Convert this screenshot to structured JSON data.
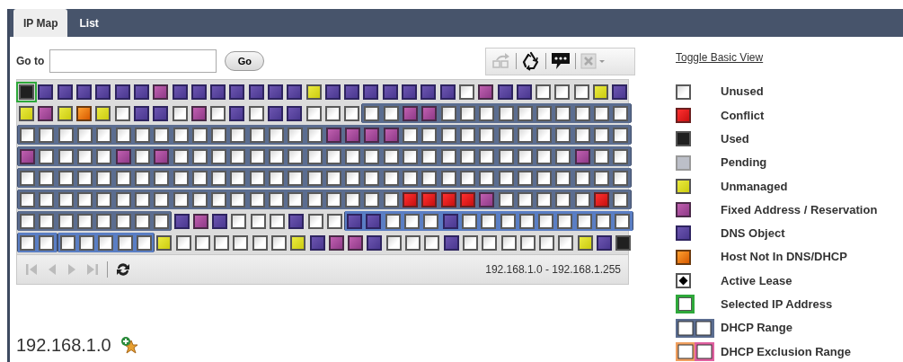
{
  "tabs": [
    {
      "label": "IP Map",
      "selected": true
    },
    {
      "label": "List",
      "selected": false
    }
  ],
  "goto": {
    "label": "Go to",
    "button": "Go"
  },
  "grid_rows": [
    {
      "cells": [
        {
          "kind": "used",
          "selected": true
        },
        {
          "kind": "dns",
          "selected": false
        },
        {
          "kind": "dns",
          "selected": false
        },
        {
          "kind": "dns",
          "selected": false
        },
        {
          "kind": "dns",
          "selected": false
        },
        {
          "kind": "dns",
          "selected": false
        },
        {
          "kind": "dns",
          "selected": false
        },
        {
          "kind": "fixed",
          "selected": false
        },
        {
          "kind": "dns",
          "selected": false
        },
        {
          "kind": "dns",
          "selected": false
        },
        {
          "kind": "dns",
          "selected": false
        },
        {
          "kind": "dns",
          "selected": false
        },
        {
          "kind": "dns",
          "selected": false
        },
        {
          "kind": "dns",
          "selected": false
        },
        {
          "kind": "dns",
          "selected": false
        },
        {
          "kind": "unmanaged",
          "selected": false
        },
        {
          "kind": "dns",
          "selected": false
        },
        {
          "kind": "dns",
          "selected": false
        },
        {
          "kind": "dns",
          "selected": false
        },
        {
          "kind": "dns",
          "selected": false
        },
        {
          "kind": "dns",
          "selected": false
        },
        {
          "kind": "dns",
          "selected": false
        },
        {
          "kind": "dns",
          "selected": false
        },
        {
          "kind": "unused",
          "selected": false
        },
        {
          "kind": "fixed",
          "selected": false
        },
        {
          "kind": "dns",
          "selected": false
        },
        {
          "kind": "dns",
          "selected": false
        },
        {
          "kind": "unused",
          "selected": false
        },
        {
          "kind": "unused",
          "selected": false
        },
        {
          "kind": "unused",
          "selected": false
        },
        {
          "kind": "unmanaged",
          "selected": false
        },
        {
          "kind": "dns",
          "selected": false
        }
      ]
    },
    {
      "cells": [
        {
          "kind": "unmanaged",
          "selected": false
        },
        {
          "kind": "fixed",
          "selected": false
        },
        {
          "kind": "unmanaged",
          "selected": false
        },
        {
          "kind": "host",
          "selected": false
        },
        {
          "kind": "unmanaged",
          "selected": false
        },
        {
          "kind": "unused",
          "selected": false
        },
        {
          "kind": "dns",
          "selected": false
        },
        {
          "kind": "dns",
          "selected": false
        },
        {
          "kind": "unused",
          "selected": false
        },
        {
          "kind": "fixed",
          "selected": false
        },
        {
          "kind": "unused",
          "selected": false
        },
        {
          "kind": "dns",
          "selected": false
        },
        {
          "kind": "unused",
          "selected": false
        },
        {
          "kind": "dns",
          "selected": false
        },
        {
          "kind": "dns",
          "selected": false
        },
        {
          "kind": "unused",
          "selected": false
        },
        {
          "kind": "unused",
          "selected": false
        },
        {
          "kind": "unused",
          "selected": false
        },
        {
          "kind": "unused",
          "selected": false,
          "color": "#5b6d90",
          "range_start": true
        },
        {
          "kind": "unused",
          "selected": false,
          "color": "#5b6d90"
        },
        {
          "kind": "fixed",
          "selected": false,
          "color": "#5b6d90"
        },
        {
          "kind": "fixed",
          "selected": false,
          "color": "#5b6d90"
        },
        {
          "kind": "unused",
          "selected": false,
          "color": "#5b6d90"
        },
        {
          "kind": "unused",
          "selected": false,
          "color": "#5b6d90"
        },
        {
          "kind": "unused",
          "selected": false,
          "color": "#5b6d90"
        },
        {
          "kind": "unused",
          "selected": false,
          "color": "#5b6d90"
        },
        {
          "kind": "unused",
          "selected": false,
          "color": "#5b6d90"
        },
        {
          "kind": "unused",
          "selected": false,
          "color": "#5b6d90"
        },
        {
          "kind": "unused",
          "selected": false,
          "color": "#5b6d90"
        },
        {
          "kind": "unused",
          "selected": false,
          "color": "#5b6d90"
        },
        {
          "kind": "unused",
          "selected": false,
          "color": "#5b6d90"
        },
        {
          "kind": "unused",
          "selected": false,
          "color": "#5b6d90"
        }
      ]
    },
    {
      "cells": [
        {
          "kind": "unused",
          "selected": false,
          "color": "#5b6d90"
        },
        {
          "kind": "unused",
          "selected": false,
          "color": "#5b6d90"
        },
        {
          "kind": "unused",
          "selected": false,
          "color": "#5b6d90"
        },
        {
          "kind": "unused",
          "selected": false,
          "color": "#5b6d90"
        },
        {
          "kind": "unused",
          "selected": false,
          "color": "#5b6d90"
        },
        {
          "kind": "unused",
          "selected": false,
          "color": "#5b6d90"
        },
        {
          "kind": "unused",
          "selected": false,
          "color": "#5b6d90"
        },
        {
          "kind": "unused",
          "selected": false,
          "color": "#5b6d90"
        },
        {
          "kind": "unused",
          "selected": false,
          "color": "#5b6d90"
        },
        {
          "kind": "unused",
          "selected": false,
          "color": "#5b6d90"
        },
        {
          "kind": "unused",
          "selected": false,
          "color": "#5b6d90"
        },
        {
          "kind": "unused",
          "selected": false,
          "color": "#5b6d90"
        },
        {
          "kind": "unused",
          "selected": false,
          "color": "#5b6d90"
        },
        {
          "kind": "unused",
          "selected": false,
          "color": "#5b6d90"
        },
        {
          "kind": "unused",
          "selected": false,
          "color": "#5b6d90"
        },
        {
          "kind": "unused",
          "selected": false,
          "color": "#5b6d90"
        },
        {
          "kind": "fixed",
          "selected": false,
          "color": "#5b6d90"
        },
        {
          "kind": "fixed",
          "selected": false,
          "color": "#5b6d90"
        },
        {
          "kind": "fixed",
          "selected": false,
          "color": "#5b6d90"
        },
        {
          "kind": "fixed",
          "selected": false,
          "color": "#5b6d90"
        },
        {
          "kind": "unused",
          "selected": false,
          "color": "#5b6d90"
        },
        {
          "kind": "unused",
          "selected": false,
          "color": "#5b6d90"
        },
        {
          "kind": "unused",
          "selected": false,
          "color": "#5b6d90"
        },
        {
          "kind": "unused",
          "selected": false,
          "color": "#5b6d90"
        },
        {
          "kind": "unused",
          "selected": false,
          "color": "#5b6d90"
        },
        {
          "kind": "unused",
          "selected": false,
          "color": "#5b6d90"
        },
        {
          "kind": "unused",
          "selected": false,
          "color": "#5b6d90"
        },
        {
          "kind": "unused",
          "selected": false,
          "color": "#5b6d90"
        },
        {
          "kind": "unused",
          "selected": false,
          "color": "#5b6d90"
        },
        {
          "kind": "unused",
          "selected": false,
          "color": "#5b6d90"
        },
        {
          "kind": "unused",
          "selected": false,
          "color": "#5b6d90"
        },
        {
          "kind": "unused",
          "selected": false,
          "color": "#5b6d90"
        }
      ]
    },
    {
      "cells": [
        {
          "kind": "fixed",
          "selected": false,
          "color": "#5b6d90"
        },
        {
          "kind": "unused",
          "selected": false,
          "color": "#5b6d90"
        },
        {
          "kind": "unused",
          "selected": false,
          "color": "#5b6d90"
        },
        {
          "kind": "unused",
          "selected": false,
          "color": "#5b6d90"
        },
        {
          "kind": "unused",
          "selected": false,
          "color": "#5b6d90"
        },
        {
          "kind": "fixed",
          "selected": false,
          "color": "#5b6d90"
        },
        {
          "kind": "unused",
          "selected": false,
          "color": "#5b6d90"
        },
        {
          "kind": "fixed",
          "selected": false,
          "color": "#5b6d90"
        },
        {
          "kind": "unused",
          "selected": false,
          "color": "#5b6d90"
        },
        {
          "kind": "unused",
          "selected": false,
          "color": "#5b6d90"
        },
        {
          "kind": "unused",
          "selected": false,
          "color": "#5b6d90"
        },
        {
          "kind": "unused",
          "selected": false,
          "color": "#5b6d90"
        },
        {
          "kind": "unused",
          "selected": false,
          "color": "#5b6d90"
        },
        {
          "kind": "unused",
          "selected": false,
          "color": "#5b6d90"
        },
        {
          "kind": "unused",
          "selected": false,
          "color": "#5b6d90"
        },
        {
          "kind": "unused",
          "selected": false,
          "color": "#5b6d90"
        },
        {
          "kind": "unused",
          "selected": false,
          "color": "#5b6d90"
        },
        {
          "kind": "unused",
          "selected": false,
          "color": "#5b6d90"
        },
        {
          "kind": "unused",
          "selected": false,
          "color": "#5b6d90"
        },
        {
          "kind": "unused",
          "selected": false,
          "color": "#5b6d90"
        },
        {
          "kind": "unused",
          "selected": false,
          "color": "#5b6d90"
        },
        {
          "kind": "unused",
          "selected": false,
          "color": "#5b6d90"
        },
        {
          "kind": "unused",
          "selected": false,
          "color": "#5b6d90"
        },
        {
          "kind": "unused",
          "selected": false,
          "color": "#5b6d90"
        },
        {
          "kind": "unused",
          "selected": false,
          "color": "#5b6d90"
        },
        {
          "kind": "unused",
          "selected": false,
          "color": "#5b6d90"
        },
        {
          "kind": "unused",
          "selected": false,
          "color": "#5b6d90"
        },
        {
          "kind": "unused",
          "selected": false,
          "color": "#5b6d90"
        },
        {
          "kind": "unused",
          "selected": false,
          "color": "#5b6d90"
        },
        {
          "kind": "fixed",
          "selected": false,
          "color": "#5b6d90"
        },
        {
          "kind": "unused",
          "selected": false,
          "color": "#5b6d90"
        },
        {
          "kind": "unused",
          "selected": false,
          "color": "#5b6d90"
        }
      ]
    },
    {
      "cells": [
        {
          "kind": "unused",
          "selected": false,
          "color": "#5b6d90"
        },
        {
          "kind": "unused",
          "selected": false,
          "color": "#5b6d90"
        },
        {
          "kind": "unused",
          "selected": false,
          "color": "#5b6d90"
        },
        {
          "kind": "unused",
          "selected": false,
          "color": "#5b6d90"
        },
        {
          "kind": "unused",
          "selected": false,
          "color": "#5b6d90"
        },
        {
          "kind": "unused",
          "selected": false,
          "color": "#5b6d90"
        },
        {
          "kind": "unused",
          "selected": false,
          "color": "#5b6d90"
        },
        {
          "kind": "unused",
          "selected": false,
          "color": "#5b6d90"
        },
        {
          "kind": "unused",
          "selected": false,
          "color": "#5b6d90"
        },
        {
          "kind": "unused",
          "selected": false,
          "color": "#5b6d90"
        },
        {
          "kind": "unused",
          "selected": false,
          "color": "#5b6d90"
        },
        {
          "kind": "unused",
          "selected": false,
          "color": "#5b6d90"
        },
        {
          "kind": "unused",
          "selected": false,
          "color": "#5b6d90"
        },
        {
          "kind": "unused",
          "selected": false,
          "color": "#5b6d90"
        },
        {
          "kind": "unused",
          "selected": false,
          "color": "#5b6d90"
        },
        {
          "kind": "unused",
          "selected": false,
          "color": "#5b6d90"
        },
        {
          "kind": "unused",
          "selected": false,
          "color": "#5b6d90"
        },
        {
          "kind": "unused",
          "selected": false,
          "color": "#5b6d90"
        },
        {
          "kind": "unused",
          "selected": false,
          "color": "#5b6d90"
        },
        {
          "kind": "unused",
          "selected": false,
          "color": "#5b6d90"
        },
        {
          "kind": "unused",
          "selected": false,
          "color": "#5b6d90"
        },
        {
          "kind": "unused",
          "selected": false,
          "color": "#5b6d90"
        },
        {
          "kind": "unused",
          "selected": false,
          "color": "#5b6d90"
        },
        {
          "kind": "unused",
          "selected": false,
          "color": "#5b6d90"
        },
        {
          "kind": "unused",
          "selected": false,
          "color": "#5b6d90"
        },
        {
          "kind": "unused",
          "selected": false,
          "color": "#5b6d90"
        },
        {
          "kind": "unused",
          "selected": false,
          "color": "#5b6d90"
        },
        {
          "kind": "unused",
          "selected": false,
          "color": "#5b6d90"
        },
        {
          "kind": "unused",
          "selected": false,
          "color": "#5b6d90"
        },
        {
          "kind": "unused",
          "selected": false,
          "color": "#5b6d90"
        },
        {
          "kind": "unused",
          "selected": false,
          "color": "#5b6d90"
        },
        {
          "kind": "unused",
          "selected": false,
          "color": "#5b6d90"
        }
      ]
    },
    {
      "cells": [
        {
          "kind": "unused",
          "selected": false,
          "color": "#5b6d90"
        },
        {
          "kind": "unused",
          "selected": false,
          "color": "#5b6d90"
        },
        {
          "kind": "unused",
          "selected": false,
          "color": "#5b6d90"
        },
        {
          "kind": "unused",
          "selected": false,
          "color": "#5b6d90"
        },
        {
          "kind": "unused",
          "selected": false,
          "color": "#5b6d90"
        },
        {
          "kind": "unused",
          "selected": false,
          "color": "#5b6d90"
        },
        {
          "kind": "unused",
          "selected": false,
          "color": "#5b6d90"
        },
        {
          "kind": "unused",
          "selected": false,
          "color": "#5b6d90"
        },
        {
          "kind": "unused",
          "selected": false,
          "color": "#5b6d90"
        },
        {
          "kind": "unused",
          "selected": false,
          "color": "#5b6d90"
        },
        {
          "kind": "unused",
          "selected": false,
          "color": "#5b6d90"
        },
        {
          "kind": "unused",
          "selected": false,
          "color": "#5b6d90"
        },
        {
          "kind": "unused",
          "selected": false,
          "color": "#5b6d90"
        },
        {
          "kind": "unused",
          "selected": false,
          "color": "#5b6d90"
        },
        {
          "kind": "unused",
          "selected": false,
          "color": "#5b6d90"
        },
        {
          "kind": "unused",
          "selected": false,
          "color": "#5b6d90"
        },
        {
          "kind": "unused",
          "selected": false,
          "color": "#5b6d90"
        },
        {
          "kind": "unused",
          "selected": false,
          "color": "#5b6d90"
        },
        {
          "kind": "unused",
          "selected": false,
          "color": "#5b6d90"
        },
        {
          "kind": "unused",
          "selected": false,
          "color": "#5b6d90"
        },
        {
          "kind": "conflict",
          "selected": false,
          "color": "#5b6d90"
        },
        {
          "kind": "conflict",
          "selected": false,
          "color": "#5b6d90"
        },
        {
          "kind": "conflict",
          "selected": false,
          "color": "#5b6d90"
        },
        {
          "kind": "conflict",
          "selected": false,
          "color": "#5b6d90"
        },
        {
          "kind": "fixed",
          "selected": false,
          "color": "#5b6d90"
        },
        {
          "kind": "unused",
          "selected": false,
          "color": "#5b6d90"
        },
        {
          "kind": "unused",
          "selected": false,
          "color": "#5b6d90"
        },
        {
          "kind": "unused",
          "selected": false,
          "color": "#5b6d90"
        },
        {
          "kind": "unused",
          "selected": false,
          "color": "#5b6d90"
        },
        {
          "kind": "unused",
          "selected": false,
          "color": "#5b6d90"
        },
        {
          "kind": "conflict",
          "selected": false,
          "color": "#5b6d90"
        },
        {
          "kind": "unused",
          "selected": false,
          "color": "#5b6d90"
        }
      ]
    },
    {
      "cells": [
        {
          "kind": "unused",
          "selected": false,
          "color": "#5b6d90"
        },
        {
          "kind": "unused",
          "selected": false,
          "color": "#5b6d90"
        },
        {
          "kind": "unused",
          "selected": false,
          "color": "#5b6d90"
        },
        {
          "kind": "unused",
          "selected": false,
          "color": "#5b6d90"
        },
        {
          "kind": "unused",
          "selected": false,
          "color": "#5b6d90"
        },
        {
          "kind": "unused",
          "selected": false,
          "color": "#5b6d90"
        },
        {
          "kind": "unused",
          "selected": false,
          "color": "#5b6d90"
        },
        {
          "kind": "unused",
          "selected": false,
          "color": "#5b6d90"
        },
        {
          "kind": "dns",
          "selected": false
        },
        {
          "kind": "fixed",
          "selected": false
        },
        {
          "kind": "dns",
          "selected": false
        },
        {
          "kind": "unused",
          "selected": false
        },
        {
          "kind": "unused",
          "selected": false
        },
        {
          "kind": "unused",
          "selected": false
        },
        {
          "kind": "dns",
          "selected": false
        },
        {
          "kind": "unused",
          "selected": false
        },
        {
          "kind": "unused",
          "selected": false
        },
        {
          "kind": "dns",
          "selected": false,
          "color": "#5a7ec4",
          "range_start": true
        },
        {
          "kind": "dns",
          "selected": false,
          "color": "#5a7ec4"
        },
        {
          "kind": "unused",
          "selected": false,
          "color": "#5a7ec4"
        },
        {
          "kind": "unused",
          "selected": false,
          "color": "#5a7ec4"
        },
        {
          "kind": "unused",
          "selected": false,
          "color": "#5a7ec4"
        },
        {
          "kind": "dns",
          "selected": false,
          "color": "#5a7ec4"
        },
        {
          "kind": "unused",
          "selected": false,
          "color": "#5a7ec4"
        },
        {
          "kind": "unused",
          "selected": false,
          "color": "#5a7ec4"
        },
        {
          "kind": "unused",
          "selected": false,
          "color": "#5a7ec4"
        },
        {
          "kind": "unused",
          "selected": false,
          "color": "#5a7ec4"
        },
        {
          "kind": "unused",
          "selected": false,
          "color": "#5a7ec4"
        },
        {
          "kind": "unused",
          "selected": false,
          "color": "#5a7ec4"
        },
        {
          "kind": "unused",
          "selected": false,
          "color": "#5a7ec4"
        },
        {
          "kind": "unused",
          "selected": false,
          "color": "#5a7ec4"
        },
        {
          "kind": "unused",
          "selected": false,
          "color": "#5a7ec4"
        }
      ]
    },
    {
      "cells": [
        {
          "kind": "unused",
          "selected": false,
          "color": "#5a7ec4"
        },
        {
          "kind": "unused",
          "selected": false,
          "color": "#5a7ec4"
        },
        {
          "kind": "unused",
          "selected": false,
          "color": "#5a7ec4",
          "range_start": true
        },
        {
          "kind": "unused",
          "selected": false,
          "color": "#5a7ec4"
        },
        {
          "kind": "unused",
          "selected": false,
          "color": "#5a7ec4"
        },
        {
          "kind": "unused",
          "selected": false,
          "color": "#5a7ec4"
        },
        {
          "kind": "unused",
          "selected": false,
          "color": "#5a7ec4"
        },
        {
          "kind": "unmanaged",
          "selected": false
        },
        {
          "kind": "unused",
          "selected": false
        },
        {
          "kind": "unused",
          "selected": false
        },
        {
          "kind": "unused",
          "selected": false
        },
        {
          "kind": "unused",
          "selected": false
        },
        {
          "kind": "unused",
          "selected": false
        },
        {
          "kind": "unused",
          "selected": false
        },
        {
          "kind": "unmanaged",
          "selected": false
        },
        {
          "kind": "dns",
          "selected": false
        },
        {
          "kind": "fixed",
          "selected": false
        },
        {
          "kind": "fixed",
          "selected": false
        },
        {
          "kind": "dns",
          "selected": false
        },
        {
          "kind": "unused",
          "selected": false
        },
        {
          "kind": "unused",
          "selected": false
        },
        {
          "kind": "unused",
          "selected": false
        },
        {
          "kind": "dns",
          "selected": false
        },
        {
          "kind": "unused",
          "selected": false
        },
        {
          "kind": "unused",
          "selected": false
        },
        {
          "kind": "unused",
          "selected": false
        },
        {
          "kind": "unused",
          "selected": false
        },
        {
          "kind": "unused",
          "selected": false
        },
        {
          "kind": "unused",
          "selected": false
        },
        {
          "kind": "unmanaged",
          "selected": false
        },
        {
          "kind": "dns",
          "selected": false
        },
        {
          "kind": "used",
          "selected": false
        }
      ]
    }
  ],
  "pager": {
    "range_text": "192.168.1.0 - 192.168.1.255"
  },
  "network_title": "192.168.1.0",
  "legend": {
    "toggle_link": "Toggle Basic View",
    "items": [
      {
        "kind": "unused",
        "label": "Unused"
      },
      {
        "kind": "conflict",
        "label": "Conflict"
      },
      {
        "kind": "used",
        "label": "Used"
      },
      {
        "kind": "pending",
        "label": "Pending"
      },
      {
        "kind": "unmanaged",
        "label": "Unmanaged"
      },
      {
        "kind": "fixed",
        "label": "Fixed Address / Reservation"
      },
      {
        "kind": "dns",
        "label": "DNS Object"
      },
      {
        "kind": "host",
        "label": "Host Not In DNS/DHCP"
      },
      {
        "kind": "lease",
        "label": "Active Lease"
      },
      {
        "kind": "selected",
        "label": "Selected IP Address"
      },
      {
        "kind": "range",
        "label": "DHCP Range"
      },
      {
        "kind": "exclusion",
        "label": "DHCP Exclusion Range"
      }
    ]
  }
}
